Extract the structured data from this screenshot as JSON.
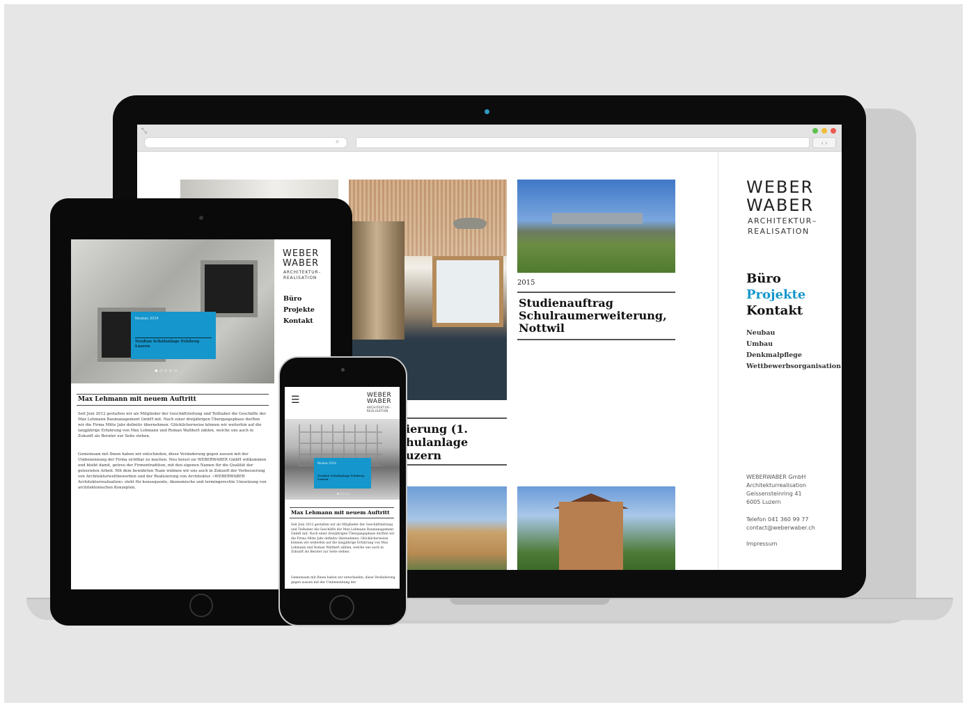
{
  "brand": {
    "logo_line1": "WEBER",
    "logo_line2": "WABER",
    "tagline_line1": "ARCHITEKTUR–",
    "tagline_line2": "REALISATION",
    "accent_color": "#1596cc"
  },
  "desktop": {
    "nav": [
      {
        "label": "Büro",
        "active": false
      },
      {
        "label": "Projekte",
        "active": true
      },
      {
        "label": "Kontakt",
        "active": false
      }
    ],
    "subnav": [
      "Neubau",
      "Umbau",
      "Denkmalpflege",
      "Wettbewerbsorganisation"
    ],
    "address": {
      "company": "WEBERWABER GmbH",
      "line1": "Architekturrealisation",
      "street": "Geissensteinring 41",
      "city": "6005 Luzern",
      "phone": "Telefon 041 360 99 77",
      "email": "contact@weberwaber.ch",
      "impressum": "Impressum"
    },
    "projects": [
      {
        "year": "2015",
        "title": "Studienauftrag Schulraumerweiterung, Nottwil"
      },
      {
        "title_partial": "ierung (1.\nhulanlage\nuzern"
      }
    ]
  },
  "tablet": {
    "nav": [
      "Büro",
      "Projekte",
      "Kontakt"
    ],
    "slide": {
      "tag": "Neubau 2014",
      "title": "Neubau Schulanlage Felsberg Luzern"
    },
    "slide_dots": "●○○○○",
    "article": {
      "title": "Max Lehmann mit neuem Auftritt",
      "paragraph1": "Seit Juni 2012 gestalten wir als Mitglieder der Geschäftsleitung und Teilhaber die Geschäfte der Max Lehmann Baumanagement GmbH mit. Nach einer dreijährigen Übergangsphase durften wir die Firma Mitte Jahr definitiv übernehmen. Glücklicherweise können wir weiterhin auf die langjährige Erfahrung von Max Lehmann und Roman Walthert zählen, welche uns auch in Zukunft als Berater zur Seite stehen.",
      "paragraph2": "Gemeinsam mit Ihnen haben wir entschieden, diese Veränderung gegen aussen mit der Umbenennung der Firma sichtbar zu machen. Neu heisst sie WEBERWABER GmbH willkommen und bleibt damit, getreu der Firmentradition, mit den eigenen Namen für die Qualität der geleisteten Arbeit. Mit dem bewährten Team widmen wir uns auch in Zukunft der Verbesserung von Architekturwettbewerben und der Realisierung von Architektur. «WEBERWABER Architekturrealisation» steht für konsequente, ökonomische und termingerechte Umsetzung von architektonischen Konzepten."
    }
  },
  "phone": {
    "slide": {
      "tag": "Neubau 2014",
      "title": "Neubau Schulanlage Felsberg Luzern"
    },
    "slide_dots": "●○○○○",
    "article": {
      "title": "Max Lehmann mit neuem Auftritt",
      "paragraph1": "Seit Juni 2012 gestalten wir als Mitglieder der Geschäftsleitung und Teilhaber die Geschäfte der Max Lehmann Baumanagement GmbH mit. Nach einer dreijährigen Übergangsphase durften wir die Firma Mitte Jahr definitiv übernehmen. Glücklicherweise können wir weiterhin auf die langjährige Erfahrung von Max Lehmann und Roman Walthert zählen, welche uns auch in Zukunft als Berater zur Seite stehen.",
      "paragraph2": "Gemeinsam mit Ihnen haben wir entschieden, diese Veränderung gegen aussen mit der Umbenennung der"
    }
  }
}
